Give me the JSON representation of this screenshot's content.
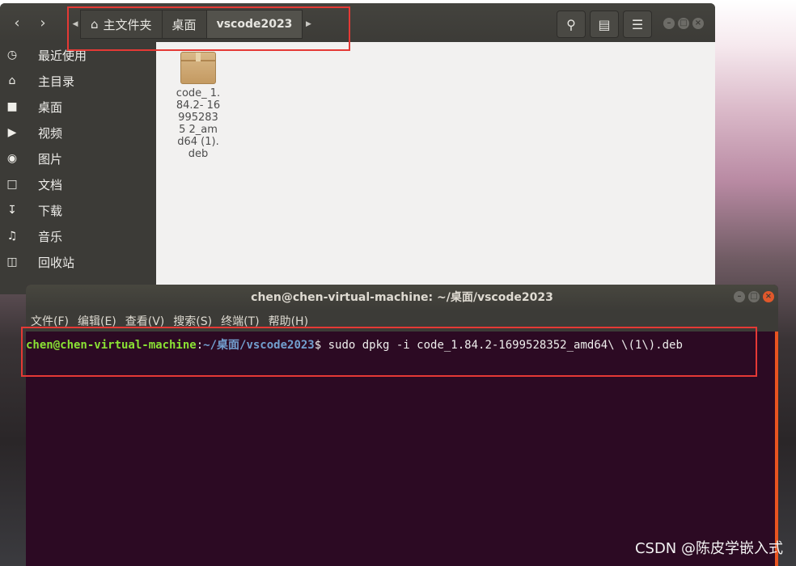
{
  "file_manager": {
    "breadcrumb": [
      "主文件夹",
      "桌面",
      "vscode2023"
    ],
    "sidebar": [
      {
        "label": "最近使用",
        "icon": "recent-icon"
      },
      {
        "label": "主目录",
        "icon": "home-icon"
      },
      {
        "label": "桌面",
        "icon": "folder-icon"
      },
      {
        "label": "视频",
        "icon": "video-icon"
      },
      {
        "label": "图片",
        "icon": "camera-icon"
      },
      {
        "label": "文档",
        "icon": "document-icon"
      },
      {
        "label": "下载",
        "icon": "download-icon"
      },
      {
        "label": "音乐",
        "icon": "music-icon"
      },
      {
        "label": "回收站",
        "icon": "trash-icon"
      }
    ],
    "files": [
      {
        "name": "code_ 1.84.2- 169952835 2_amd64 (1).deb",
        "icon": "package-icon"
      }
    ]
  },
  "terminal": {
    "title": "chen@chen-virtual-machine: ~/桌面/vscode2023",
    "menu": [
      "文件(F)",
      "编辑(E)",
      "查看(V)",
      "搜索(S)",
      "终端(T)",
      "帮助(H)"
    ],
    "prompt_user": "chen@chen-virtual-machine",
    "prompt_sep": ":",
    "prompt_path": "~/桌面/vscode2023",
    "prompt_symbol": "$ ",
    "command": "sudo dpkg -i code_1.84.2-1699528352_amd64\\ \\(1\\).deb"
  },
  "watermark": "CSDN @陈皮学嵌入式",
  "colors": {
    "highlight_box": "#e53935",
    "terminal_bg": "#2c0a23",
    "prompt_user": "#8ae234",
    "prompt_path": "#729fcf"
  }
}
